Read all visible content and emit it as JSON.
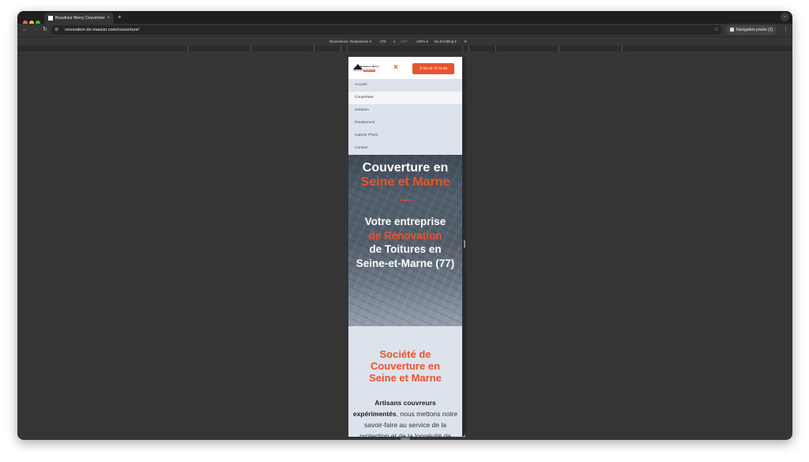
{
  "browser": {
    "tab_title": "Beaubour Mercy Couverture",
    "tab_close": "×",
    "new_tab": "+",
    "url": "renovation-de-maison.com/couverture/",
    "private_label": "Navigation privée (2)",
    "back": "←",
    "forward": "→",
    "reload": "↻",
    "bookmark": "☆",
    "menu": "⋮"
  },
  "devtools": {
    "dimensions": "Dimensions: Responsive ▾",
    "width": "375",
    "times": "x",
    "height": "1287",
    "zoom": "100% ▾",
    "throttling": "No throttling ▾"
  },
  "site": {
    "logo_name": "Beaubour Mercy",
    "logo_sub_1": "Couverture",
    "logo_sub_2": "Ravalement",
    "close_icon": "×",
    "phone_button": "✆ 06 00 72 76 60",
    "menu": [
      {
        "label": "Accueil",
        "active": false
      },
      {
        "label": "Couverture",
        "active": true
      },
      {
        "label": "Isolation",
        "active": false
      },
      {
        "label": "Ravalement",
        "active": false
      },
      {
        "label": "Galerie Photo",
        "active": false
      },
      {
        "label": "Contact",
        "active": false
      }
    ],
    "hero": {
      "title_line1": "Couverture en",
      "title_line2": "Seine et Marne",
      "subtitle_line1": "Votre entreprise",
      "subtitle_line2": "de Rénovation",
      "subtitle_line3": "de Toitures en",
      "subtitle_line4": "Seine-et-Marne (77)"
    },
    "section": {
      "title_line1": "Société de",
      "title_line2": "Couverture en",
      "title_line3": "Seine et Marne",
      "para_bold": "Artisans couvreurs expérimentés",
      "para_rest": ", nous mettons notre savoir-faire au service de la protection et de la longévité de"
    }
  },
  "colors": {
    "accent": "#e8542c",
    "menu_bg": "#dde3ec",
    "chrome_bg": "#353535"
  }
}
